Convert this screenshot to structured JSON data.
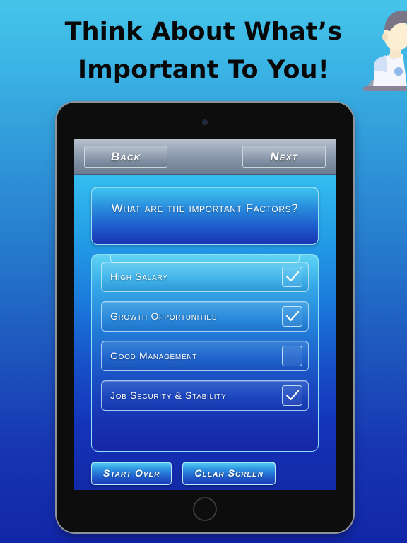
{
  "headline": {
    "line1": "Think About What’s",
    "line2": "Important To You!"
  },
  "illustration": {
    "name": "person-at-desk-illustration"
  },
  "tablet": {
    "nav": {
      "back_label": "Back",
      "next_label": "Next"
    },
    "question": "What are the important Factors?",
    "list": [
      {
        "label": "High Salary",
        "checked": true
      },
      {
        "label": "Growth Opportunities",
        "checked": true
      },
      {
        "label": "Good Management",
        "checked": false
      },
      {
        "label": "Job Security & Stability",
        "checked": true
      }
    ],
    "actions": {
      "start_over_label": "Start Over",
      "clear_screen_label": "Clear Screen"
    }
  },
  "colors": {
    "page_gradient_top": "#45c4ea",
    "page_gradient_bottom": "#1226a8",
    "screen_gradient_top": "#4bd3f5",
    "screen_gradient_bottom": "#122aa8",
    "nav_bar_top": "#b7c0cc",
    "nav_bar_bottom": "#6e7d93",
    "bezel": "#0d0d0d",
    "bezel_edge": "#8e9398",
    "accent_cyan": "#54cdf3",
    "accent_blue": "#1a3cbb",
    "text_white": "#ffffff",
    "headline_text": "#080808"
  }
}
